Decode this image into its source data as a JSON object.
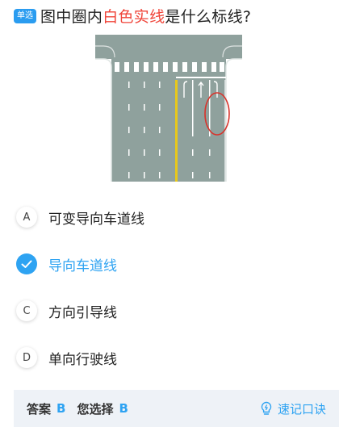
{
  "question": {
    "type_tag": "单选",
    "text_before": "图中圈内",
    "text_highlight": "白色实线",
    "text_after": "是什么标线?"
  },
  "options": [
    {
      "letter": "A",
      "label": "可变导向车道线",
      "selected": false
    },
    {
      "letter": "B",
      "label": "导向车道线",
      "selected": true
    },
    {
      "letter": "C",
      "label": "方向引导线",
      "selected": false
    },
    {
      "letter": "D",
      "label": "单向行驶线",
      "selected": false
    }
  ],
  "answer_bar": {
    "answer_key": "答案",
    "answer_value": "B",
    "your_choice_key": "您选择",
    "your_choice_value": "B",
    "tip_label": "速记口诀"
  },
  "colors": {
    "accent": "#2ea3f2",
    "highlight": "#f0453a",
    "road": "#8fa19d",
    "center_line": "#e8c81a"
  }
}
